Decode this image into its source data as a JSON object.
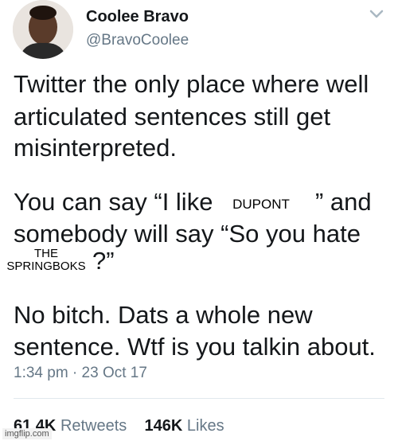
{
  "tweet": {
    "display_name": "Coolee Bravo",
    "handle": "@BravoCoolee",
    "lines": [
      "Twitter the only place where well",
      "articulated sentences still get",
      "misinterpreted.",
      "You can say “I like",
      "” and",
      "somebody will say “So you hate",
      "?”",
      "No bitch. Dats a whole new",
      "sentence. Wtf is you talkin about."
    ],
    "overlay_team_1": "DUPONT",
    "overlay_team_2_line1": "THE",
    "overlay_team_2_line2": "SPRINGBOKS",
    "timestamp": "1:34 pm · 23 Oct 17",
    "retweets_count": "61.4K",
    "retweets_label": "Retweets",
    "likes_count": "146K",
    "likes_label": "Likes"
  },
  "watermark": "imgflip.com",
  "icons": {
    "menu": "chevron-down-icon",
    "avatar": "avatar"
  }
}
